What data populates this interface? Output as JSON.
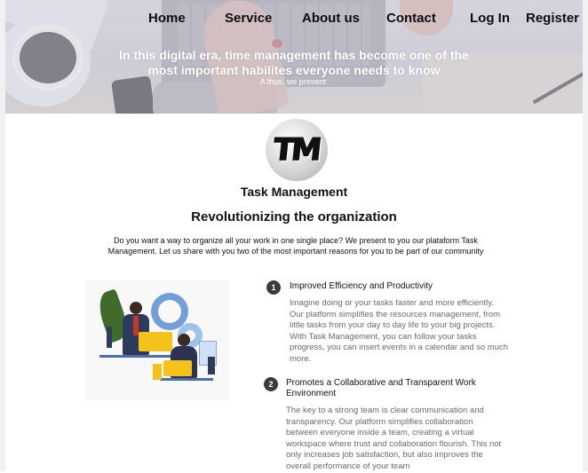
{
  "nav": {
    "home": "Home",
    "service": "Service",
    "about": "About us",
    "contact": "Contact",
    "login": "Log In",
    "register": "Register"
  },
  "hero": {
    "line1": "In this digital era, time management has become one of the",
    "line2": "most important habilites everyone needs to know",
    "subtitle": "A thus, we present:"
  },
  "logo": {
    "text": "TM"
  },
  "brand": "Task Management",
  "headline": "Revolutionizing the organization",
  "intro": {
    "line1": "Do you want a way to organize all your work in one single place? We present to you our plataform Task",
    "line2": "Management. Let us share with you two of the most important reasons for you to be part of our community"
  },
  "reasons": [
    {
      "number": "1",
      "title": "Improved Efficiency and Productivity",
      "body": [
        "Imagine doing or your tasks faster and more efficiently.",
        "Our platform simplifies the resources management, from",
        "little tasks from your day to day life to your big projects.",
        "With Task Management, you can follow your tasks",
        "progress, you can insert events in a calendar and so much",
        "more."
      ]
    },
    {
      "number": "2",
      "title_line1": "Promotes a Collaborative and Transparent Work",
      "title_line2": "Environment",
      "body": [
        "The key to a strong team is clear communication and",
        "transparency. Our platform simplifies collaboration",
        "between everyone inside a team, creating a virtual",
        "workspace where trust and collaboration flourish. This not",
        "only increases job satisfaction, but also improves the",
        "overall performance of your team"
      ]
    }
  ],
  "colors": {
    "nav_text": "#0d0d12",
    "hero_text": "#ffffff",
    "body_text": "#111111",
    "muted_text": "#6b6b6b",
    "badge": "#3b3b3b",
    "illustration_accent": "#f5c21b"
  }
}
